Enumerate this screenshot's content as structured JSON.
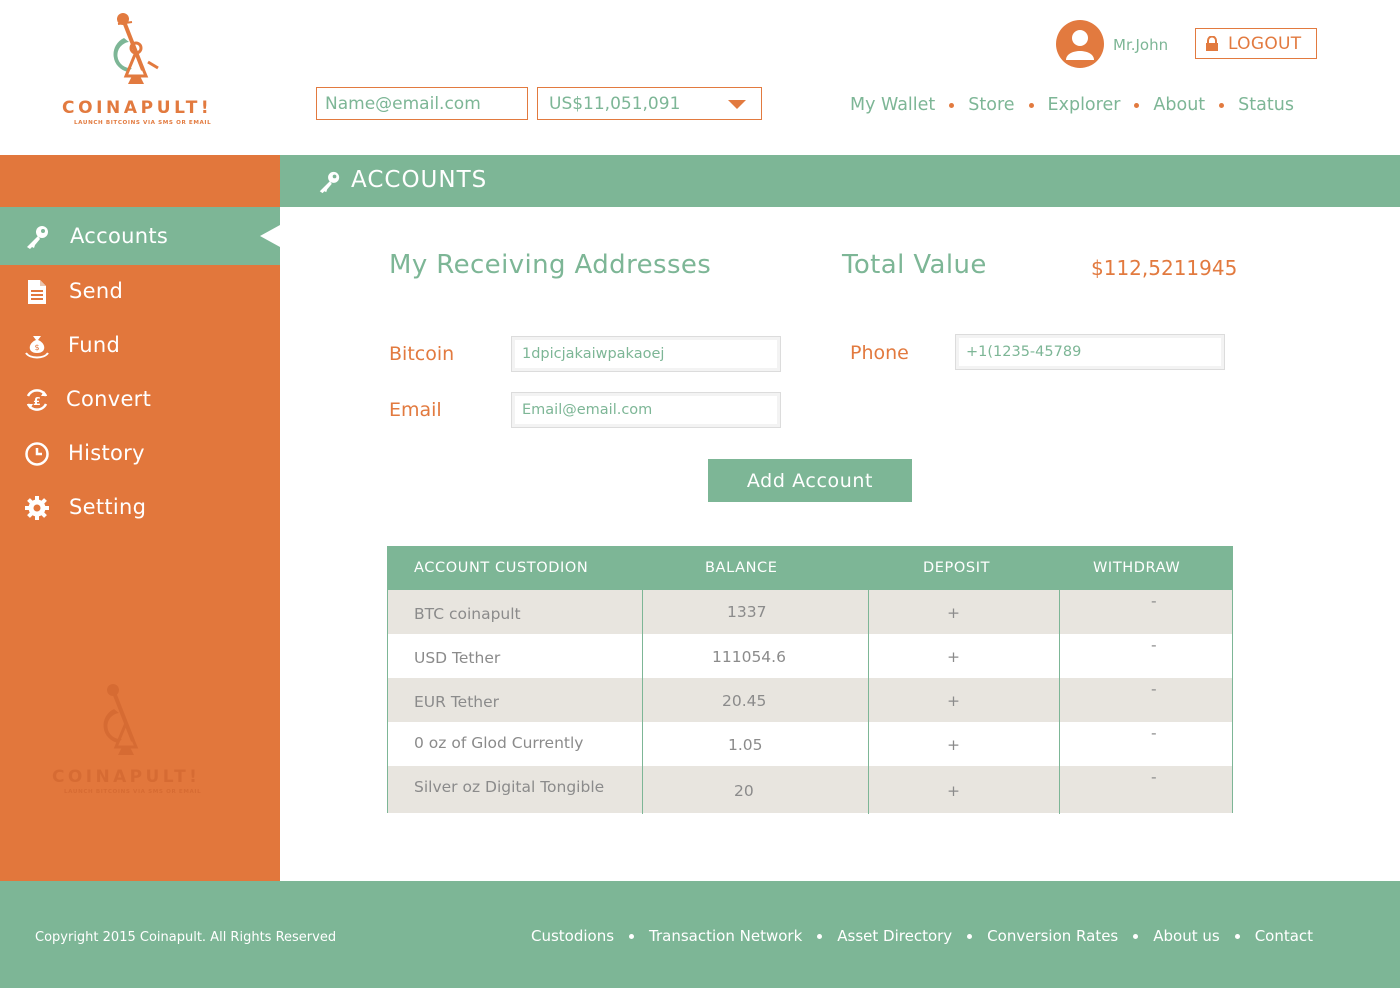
{
  "brand": {
    "name": "COINAPULT!",
    "tagline": "LAUNCH BITCOINS VIA SMS OR EMAIL",
    "primary_color": "#e27a3f",
    "accent_color": "#7db696"
  },
  "header": {
    "email_placeholder": "Name@email.com",
    "balance_selected": "US$11,051,091",
    "user_name": "Mr.John",
    "logout_label": "LOGOUT",
    "nav": [
      "My Wallet",
      "Store",
      "Explorer",
      "About",
      "Status"
    ]
  },
  "sidebar": {
    "items": [
      {
        "label": "Accounts",
        "icon": "key-icon",
        "active": true
      },
      {
        "label": "Send",
        "icon": "document-icon"
      },
      {
        "label": "Fund",
        "icon": "money-bag-icon"
      },
      {
        "label": "Convert",
        "icon": "currency-convert-icon"
      },
      {
        "label": "History",
        "icon": "clock-icon"
      },
      {
        "label": "Setting",
        "icon": "gear-icon"
      }
    ]
  },
  "main": {
    "section_title": "ACCOUNTS",
    "receiving_heading": "My Receiving Addresses",
    "total_heading": "Total Value",
    "total_value": "$112,5211945",
    "fields": {
      "bitcoin_label": "Bitcoin",
      "bitcoin_value": "1dpicjakaiwpakaoej",
      "email_label": "Email",
      "email_value": "Email@email.com",
      "phone_label": "Phone",
      "phone_value": "+1(1235-45789"
    },
    "add_account_label": "Add Account",
    "table": {
      "headers": [
        "ACCOUNT CUSTODION",
        "BALANCE",
        "DEPOSIT",
        "WITHDRAW"
      ],
      "rows": [
        {
          "custodian": "BTC coinapult",
          "balance": "1337",
          "deposit": "+",
          "withdraw": "-"
        },
        {
          "custodian": "USD Tether",
          "balance": "111054.6",
          "deposit": "+",
          "withdraw": "-"
        },
        {
          "custodian": "EUR Tether",
          "balance": "20.45",
          "deposit": "+",
          "withdraw": "-"
        },
        {
          "custodian": "0 oz of Glod Currently",
          "balance": "1.05",
          "deposit": "+",
          "withdraw": "-"
        },
        {
          "custodian": "Silver oz Digital Tongible",
          "balance": "20",
          "deposit": "+",
          "withdraw": "-"
        }
      ]
    }
  },
  "footer": {
    "copyright": "Copyright 2015 Coinapult. All Rights Reserved",
    "links": [
      "Custodions",
      "Transaction Network",
      "Asset Directory",
      "Conversion Rates",
      "About us",
      "Contact"
    ]
  }
}
